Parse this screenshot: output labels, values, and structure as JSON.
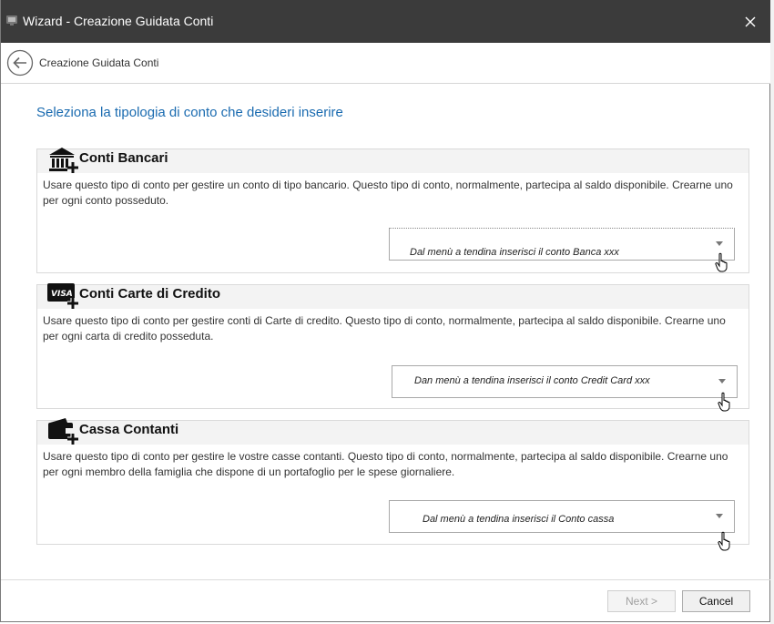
{
  "window": {
    "title": "Wizard - Creazione Guidata Conti"
  },
  "nav": {
    "title": "Creazione Guidata Conti"
  },
  "heading": "Seleziona la tipologia di conto che desideri inserire",
  "sections": [
    {
      "title": "Conti Bancari",
      "icon": "bank-add-icon",
      "description": "Usare questo tipo di conto per gestire un conto di tipo bancario. Questo tipo di conto, normalmente, partecipa al saldo disponibile. Crearne uno per ogni conto posseduto.",
      "combo": "Dal menù a tendina inserisci il conto Banca xxx"
    },
    {
      "title": "Conti Carte di Credito",
      "icon": "visa-card-add-icon",
      "description": "Usare questo tipo di conto per gestire conti di Carte di credito. Questo tipo di conto, normalmente, partecipa al saldo disponibile. Crearne uno per ogni carta di credito posseduta.",
      "combo": "Dan menù a tendina inserisci il conto Credit Card xxx"
    },
    {
      "title": "Cassa Contanti",
      "icon": "wallet-add-icon",
      "description": "Usare questo tipo di conto per gestire le vostre casse contanti. Questo tipo di conto, normalmente, partecipa al saldo disponibile. Crearne uno per ogni membro della famiglia che dispone di un portafoglio per le spese giornaliere.",
      "combo": "Dal menù a tendina inserisci il Conto cassa"
    }
  ],
  "buttons": {
    "next": "Next >",
    "cancel": "Cancel"
  },
  "colors": {
    "titlebar": "#3b3b3b",
    "heading": "#1a6bb0",
    "section_header": "#f3f3f3"
  }
}
